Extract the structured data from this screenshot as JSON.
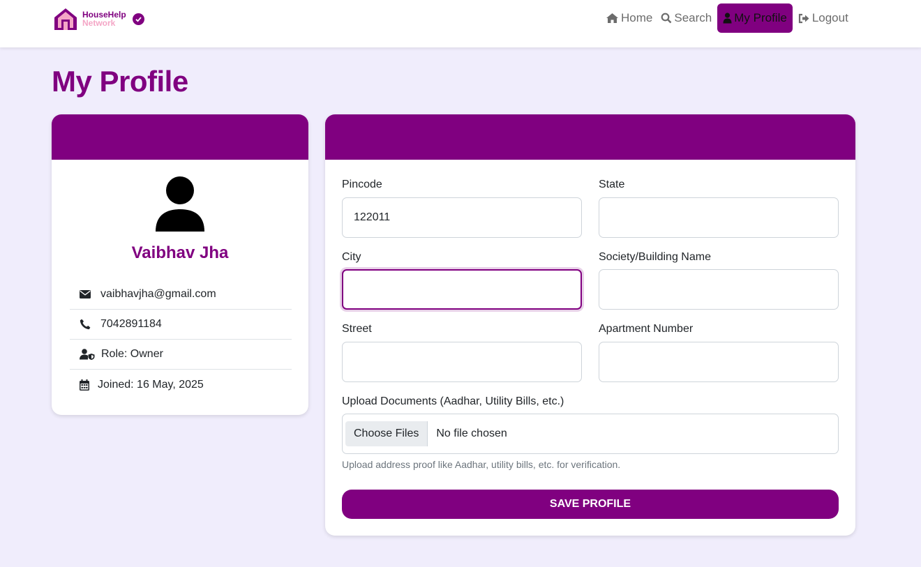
{
  "brand": {
    "line1": "HouseHelp",
    "line2": "Network"
  },
  "nav": {
    "home": "Home",
    "search": "Search",
    "profile": "My Profile",
    "logout": "Logout"
  },
  "page": {
    "title": "My Profile"
  },
  "profile": {
    "name": "Vaibhav Jha",
    "email": "vaibhavjha@gmail.com",
    "phone": "7042891184",
    "role": "Role: Owner",
    "joined": "Joined: 16 May, 2025"
  },
  "form": {
    "pincode_label": "Pincode",
    "pincode_value": "122011",
    "state_label": "State",
    "state_value": "",
    "city_label": "City",
    "city_value": "",
    "society_label": "Society/Building Name",
    "society_value": "",
    "street_label": "Street",
    "street_value": "",
    "apartment_label": "Apartment Number",
    "apartment_value": "",
    "upload_label": "Upload Documents (Aadhar, Utility Bills, etc.)",
    "choose_files": "Choose Files",
    "no_file": "No file chosen",
    "help_text": "Upload address proof like Aadhar, utility bills, etc. for verification.",
    "save_label": "SAVE PROFILE"
  },
  "colors": {
    "brand": "#800080",
    "accent_pink": "#f4a6c6",
    "background": "#f0edfc"
  }
}
